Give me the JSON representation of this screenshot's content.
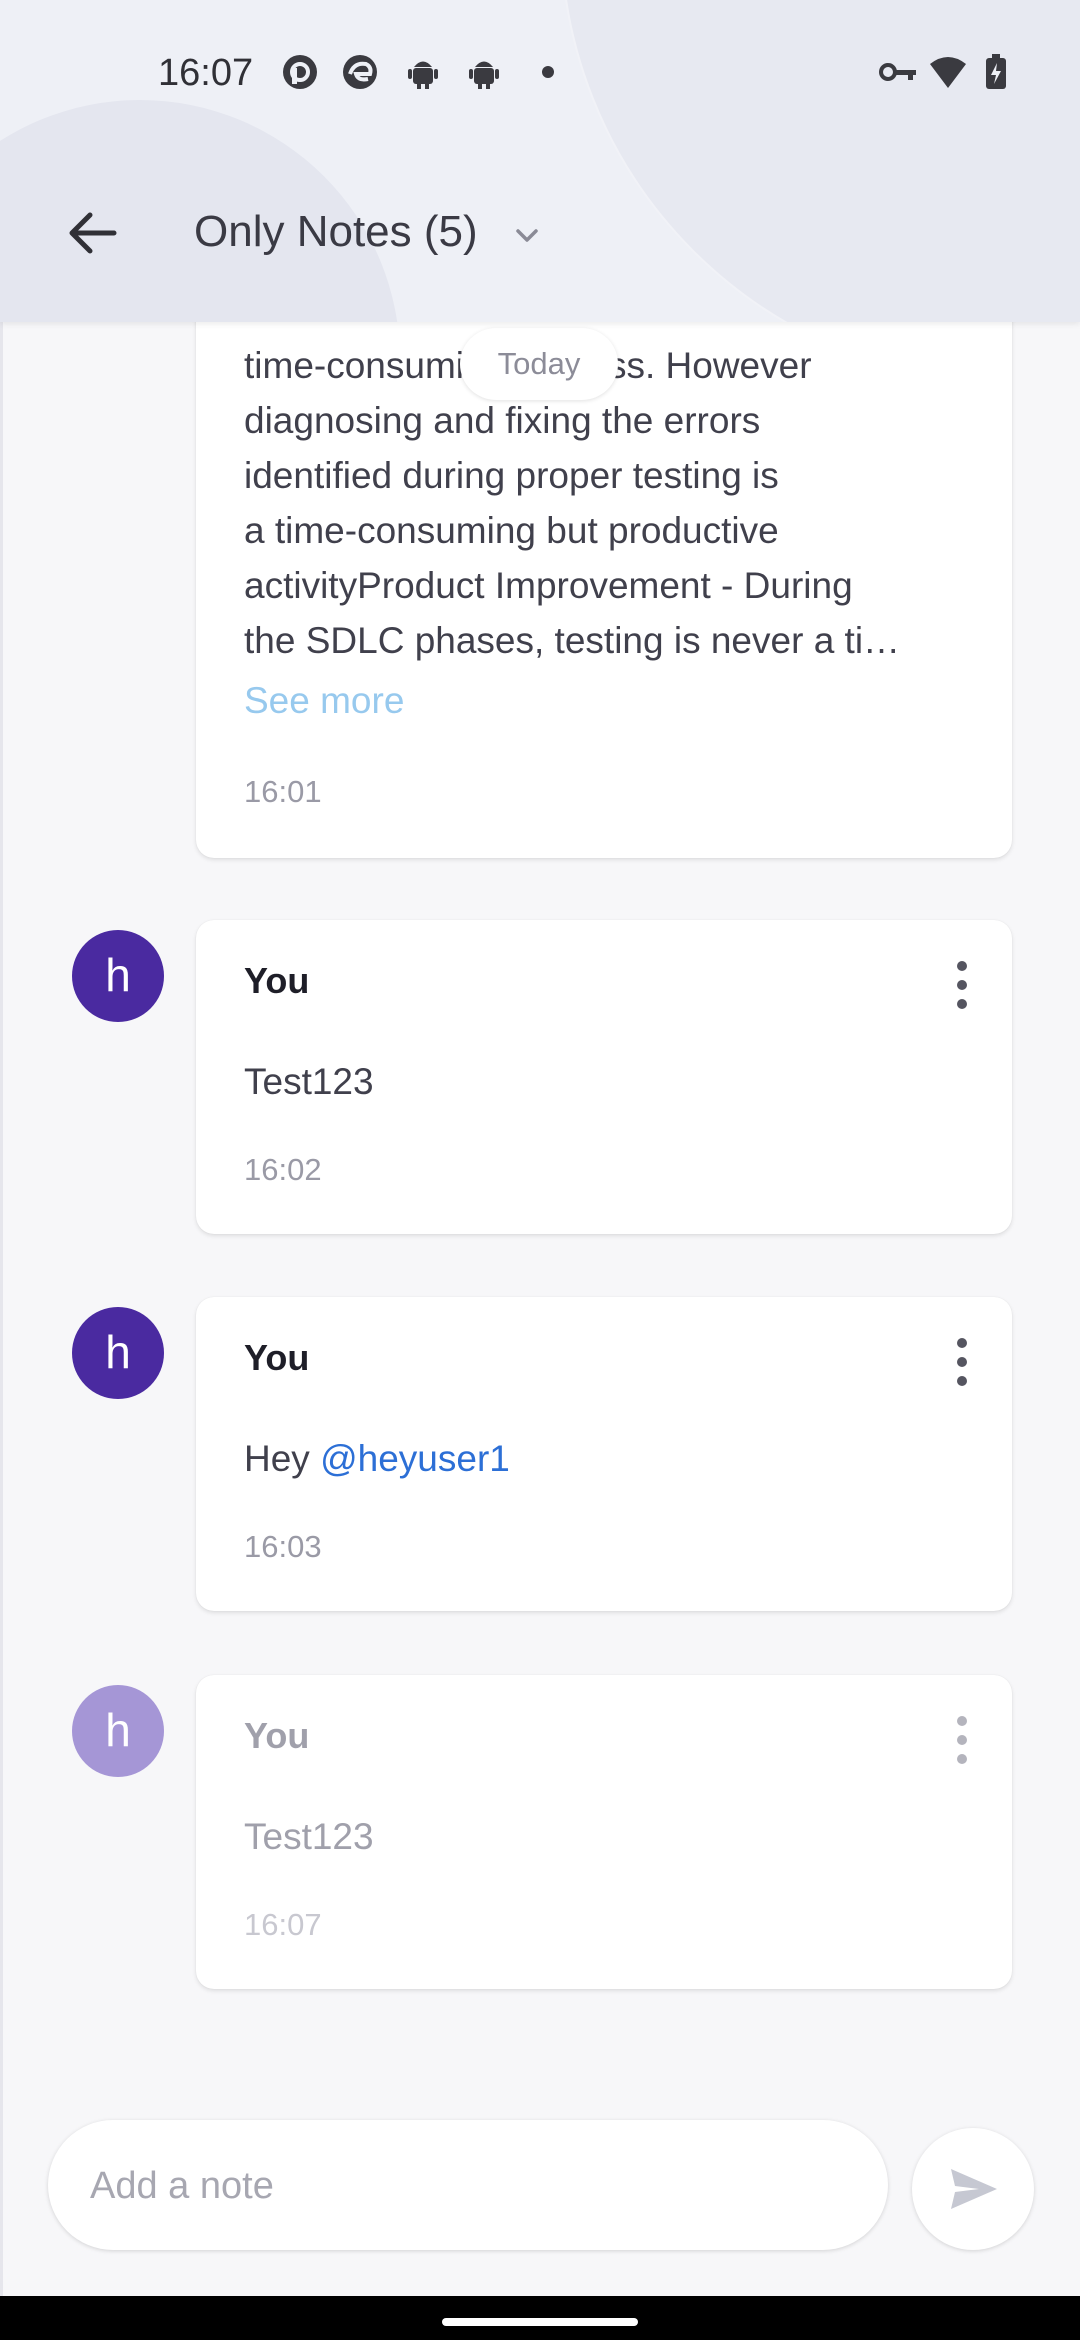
{
  "status_bar": {
    "time": "16:07",
    "left_icons": [
      "pocket-casts-icon",
      "edge-icon",
      "android-icon",
      "android-icon",
      "dot-icon"
    ],
    "right_icons": [
      "vpn-key-icon",
      "wifi-icon",
      "battery-charging-icon"
    ]
  },
  "app_bar": {
    "back_icon": "arrow-left-icon",
    "title": "Only Notes (5)",
    "dropdown_icon": "chevron-down-icon"
  },
  "date_chip": "Today",
  "messages": [
    {
      "text_lines": [
        "time-consuming process. However",
        "diagnosing and fixing the errors",
        "identified during proper testing is",
        "a time-consuming but productive",
        "activityProduct Improvement - During",
        "the SDLC phases, testing is never a ti…"
      ],
      "see_more": "See more",
      "time": "16:01"
    },
    {
      "avatar": "h",
      "author": "You",
      "text": "Test123",
      "time": "16:02"
    },
    {
      "avatar": "h",
      "author": "You",
      "text_prefix": "Hey ",
      "mention": "@heyuser1",
      "time": "16:03"
    },
    {
      "avatar": "h",
      "author": "You",
      "text": "Test123",
      "time": "16:07",
      "pending": true
    }
  ],
  "composer": {
    "placeholder": "Add a note",
    "send_icon": "send-icon"
  },
  "colors": {
    "avatar": "#4a2aa0",
    "avatar_pending": "#a596d6",
    "mention": "#2c6fd6",
    "see_more": "#97c9ee"
  }
}
